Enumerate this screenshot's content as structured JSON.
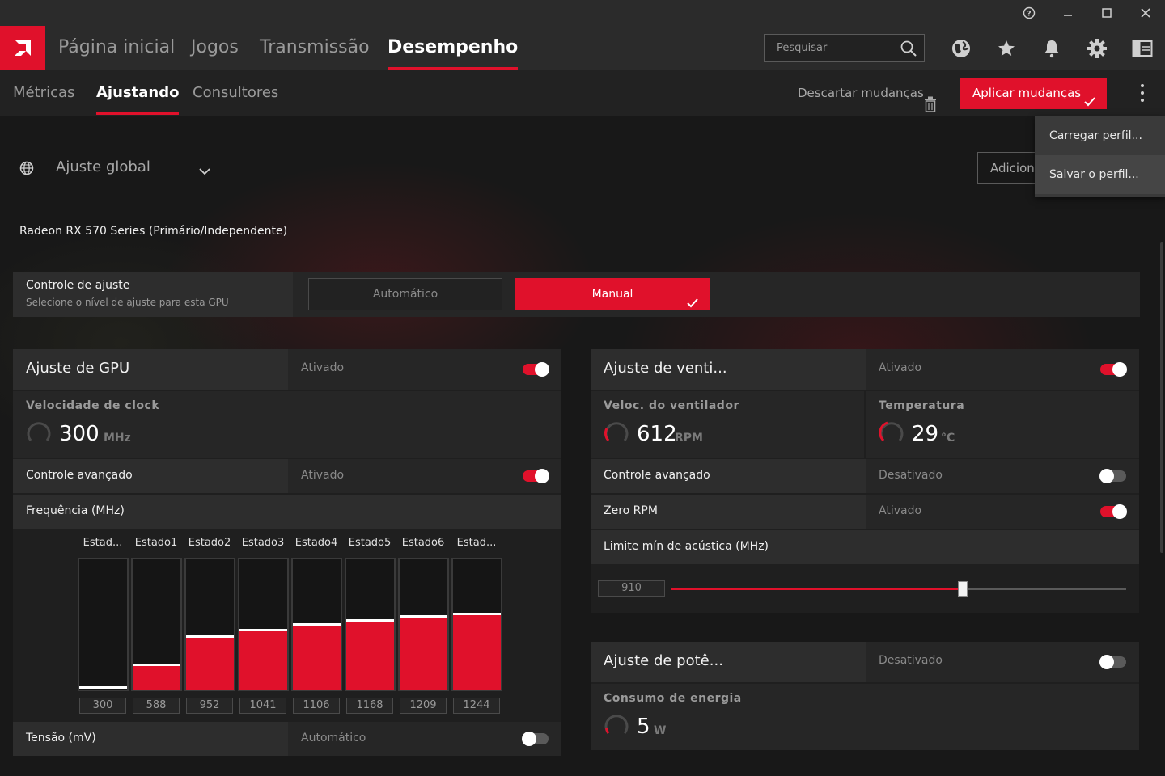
{
  "titlebar": {
    "help_icon": "help-circle-icon",
    "min_icon": "minimize-icon",
    "max_icon": "maximize-icon",
    "close_icon": "close-icon"
  },
  "nav": {
    "items": [
      "Página inicial",
      "Jogos",
      "Transmissão",
      "Desempenho"
    ],
    "active": "Desempenho",
    "search_placeholder": "Pesquisar"
  },
  "subnav": {
    "tabs": [
      "Métricas",
      "Ajustando",
      "Consultores"
    ],
    "active": "Ajustando",
    "discard": "Descartar mudanças",
    "apply": "Aplicar mudanças"
  },
  "menu": {
    "items": [
      "Carregar perfil...",
      "Salvar o perfil..."
    ]
  },
  "global": {
    "label": "Ajuste global",
    "add_button": "Adicionar"
  },
  "gpu_name": "Radeon RX 570 Series (Primário/Independente)",
  "control": {
    "title": "Controle de ajuste",
    "subtitle": "Selecione o nível de ajuste para esta GPU",
    "auto": "Automático",
    "manual": "Manual"
  },
  "gpu_panel": {
    "title": "Ajuste de GPU",
    "status": "Ativado",
    "enabled": true,
    "clock_title": "Velocidade de clock",
    "clock_value": "300",
    "clock_unit": "MHz",
    "adv_label": "Controle avançado",
    "adv_status": "Ativado",
    "adv_enabled": true,
    "freq_label": "Frequência (MHz)",
    "states": [
      {
        "label": "Estad...",
        "value": "300",
        "level": 0.0
      },
      {
        "label": "Estado1",
        "value": "588",
        "level": 0.18
      },
      {
        "label": "Estado2",
        "value": "952",
        "level": 0.4
      },
      {
        "label": "Estado3",
        "value": "1041",
        "level": 0.45
      },
      {
        "label": "Estado4",
        "value": "1106",
        "level": 0.49
      },
      {
        "label": "Estado5",
        "value": "1168",
        "level": 0.52
      },
      {
        "label": "Estado6",
        "value": "1209",
        "level": 0.55
      },
      {
        "label": "Estad...",
        "value": "1244",
        "level": 0.57
      }
    ],
    "voltage_label": "Tensão (mV)",
    "voltage_status": "Automático",
    "voltage_enabled": false
  },
  "fan_panel": {
    "title": "Ajuste de venti...",
    "status": "Ativado",
    "enabled": true,
    "speed_title": "Veloc. do ventilador",
    "speed_value": "612",
    "speed_unit": "RPM",
    "temp_title": "Temperatura",
    "temp_value": "29",
    "temp_unit": "°C",
    "adv_label": "Controle avançado",
    "adv_status": "Desativado",
    "adv_enabled": false,
    "zero_label": "Zero RPM",
    "zero_status": "Ativado",
    "zero_enabled": true,
    "acoustic_label": "Limite mín de acústica (MHz)",
    "acoustic_value": "910",
    "acoustic_fraction": 0.64
  },
  "power_panel": {
    "title": "Ajuste de potê...",
    "status": "Desativado",
    "enabled": false,
    "consumption_title": "Consumo de energia",
    "consumption_value": "5",
    "consumption_unit": "W"
  },
  "colors": {
    "accent": "#e0112b",
    "panel": "#2d2d2d",
    "bg": "#181818"
  }
}
